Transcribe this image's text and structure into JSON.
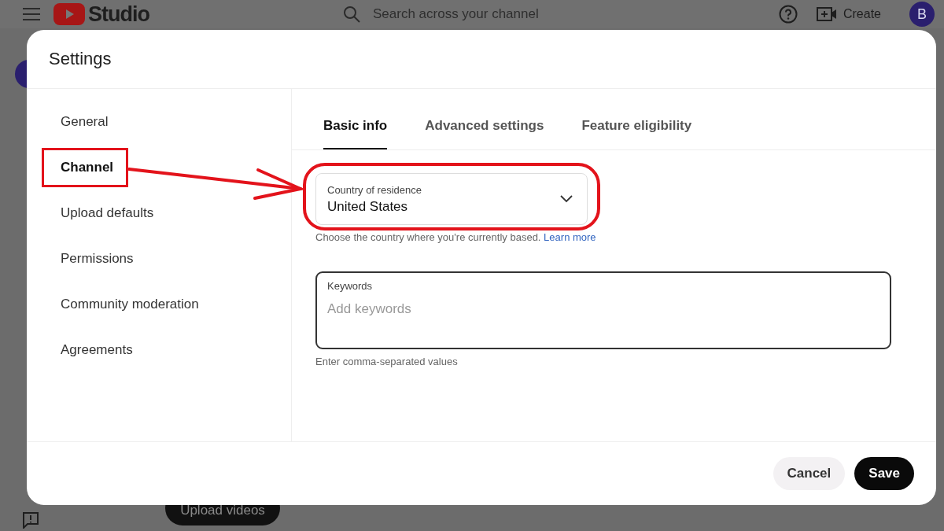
{
  "top_bar": {
    "logo": "Studio",
    "search": {
      "placeholder": "Search across your channel"
    },
    "create_button": "Create",
    "avatar": "B"
  },
  "background": {
    "upload_button": "Upload videos"
  },
  "dialog": {
    "title": "Settings",
    "nav": [
      {
        "label": "General",
        "selected": false
      },
      {
        "label": "Channel",
        "selected": true
      },
      {
        "label": "Upload defaults",
        "selected": false
      },
      {
        "label": "Permissions",
        "selected": false
      },
      {
        "label": "Community moderation",
        "selected": false
      },
      {
        "label": "Agreements",
        "selected": false
      }
    ],
    "tabs": [
      {
        "label": "Basic info",
        "selected": true
      },
      {
        "label": "Advanced settings",
        "selected": false
      },
      {
        "label": "Feature eligibility",
        "selected": false
      }
    ],
    "country_field": {
      "label": "Country of residence",
      "value": "United States",
      "helper": "Choose the country where you're currently based.",
      "link": "Learn more"
    },
    "keywords_field": {
      "label": "Keywords",
      "placeholder": "Add keywords",
      "helper": "Enter comma-separated values"
    },
    "buttons": [
      {
        "label": "Cancel",
        "kind": "secondary"
      },
      {
        "label": "Save",
        "kind": "primary"
      }
    ]
  }
}
